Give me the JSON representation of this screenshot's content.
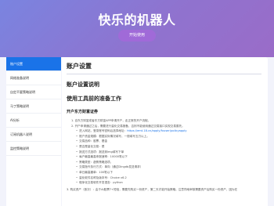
{
  "header": {
    "title": "快乐的机器人",
    "start_button": "开始使用"
  },
  "sidebar": {
    "items": [
      {
        "label": "账户设置",
        "active": true
      },
      {
        "label": "网络准备说明"
      },
      {
        "label": "自定不要策略说明"
      },
      {
        "label": "马丁策略说明"
      },
      {
        "label": "AI分析"
      },
      {
        "label": "订阅机器人说明"
      },
      {
        "label": "监控策略说明"
      }
    ]
  },
  "main": {
    "page_title": "账户设置",
    "section_title": "账户设置说明",
    "subsection_title": "使用工具前的准备工作",
    "step_title": "开户东方财富证券",
    "steps": [
      "1. 自东方财富或者东方财富APP申请开户，走正常的开户流程。",
      "2. 开户申请通过之后，需要进行量化交易报备，否则不能使用通过交易接口实现交易委托。"
    ],
    "sub_items": [
      {
        "text": "进入网站，登录账号密码后选择地址：",
        "link": "https://emt.18.cn/apply/fxuser/policyapply"
      },
      {
        "text": "账户资金规模：根据实际情况填写，一般填写五万以上。"
      },
      {
        "text": "交易品种：股票、基金"
      },
      {
        "text": "是否是量化交易：是"
      },
      {
        "text": "报送方式选项：报送到lmg填写下单"
      },
      {
        "text": "每户最高最高申报速率：10000笔以下"
      },
      {
        "text": "策略类型：趋势策略选项。"
      },
      {
        "text": "交易指令执行方式：单向（通过Dingdb发送请求）"
      },
      {
        "text": "单日最高撤单：100笔以下"
      },
      {
        "text": "量化软件名称及版本号：Choice v6.2"
      },
      {
        "text": "程序化交易软件开发语言：python"
      }
    ],
    "footer_para": "3. 购买资产（首次）：由于AI股票7+短信，需要先购买一份资产，第二天才能开始策略。注意同地审核需要资产后购买一份资产，因为在"
  }
}
